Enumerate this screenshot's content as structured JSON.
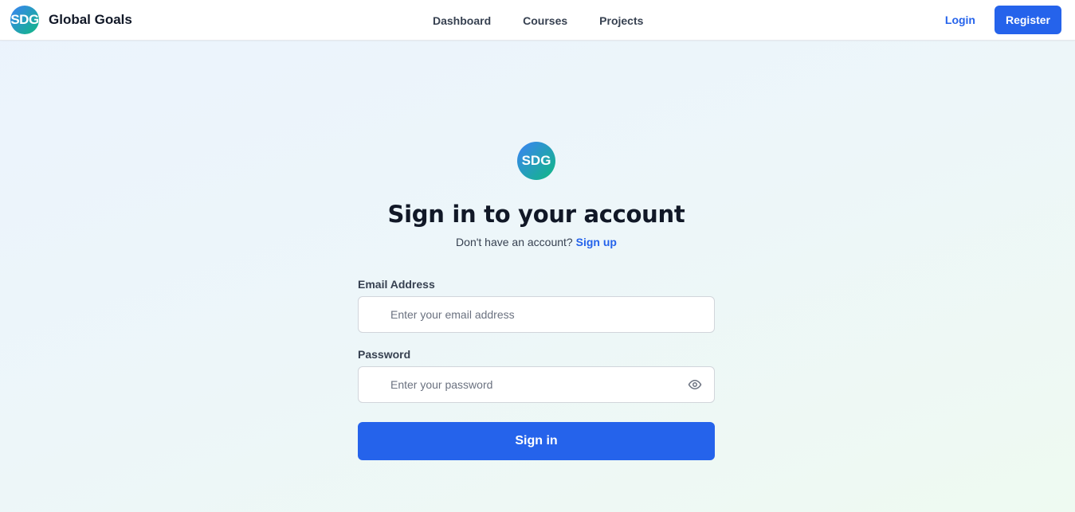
{
  "nav": {
    "logo_text": "SDG",
    "brand": "Global Goals",
    "links": [
      "Dashboard",
      "Courses",
      "Projects"
    ],
    "login": "Login",
    "register": "Register"
  },
  "auth": {
    "logo_text": "SDG",
    "title": "Sign in to your account",
    "subtitle": "Don't have an account?",
    "signup_link": "Sign up",
    "email_label": "Email Address",
    "email_placeholder": "Enter your email address",
    "email_value": "",
    "password_label": "Password",
    "password_placeholder": "Enter your password",
    "password_value": "",
    "submit": "Sign in"
  },
  "icons": {
    "password_toggle": "eye-icon"
  },
  "colors": {
    "primary": "#2563eb",
    "logo_gradient_start": "#3b82f6",
    "logo_gradient_end": "#10b981"
  }
}
